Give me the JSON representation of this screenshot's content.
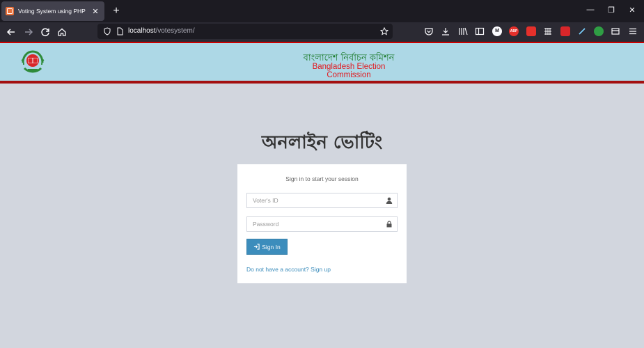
{
  "browser": {
    "tab_title": "Voting System using PHP",
    "tab_close": "✕",
    "new_tab": "+",
    "url_host": "localhost",
    "url_path": "/votesystem/",
    "window_controls": [
      "—",
      "❐",
      "✕"
    ]
  },
  "header": {
    "title_bn": "বাংলাদেশ নির্বাচন কমিশন",
    "title_en": "Bangladesh Election Commission"
  },
  "login": {
    "heading": "অনলাইন ভোটিং",
    "message": "Sign in to start your session",
    "voter_id_placeholder": "Voter's ID",
    "password_placeholder": "Password",
    "signin_label": "Sign In",
    "signup_text": "Do not have a account? Sign up"
  },
  "colors": {
    "header_bg": "#add8e6",
    "header_border": "#a30f0f",
    "page_bg": "#d2d6de",
    "button_bg": "#3c8dbc",
    "title_green": "#1a7a2a",
    "title_red": "#e2191f"
  },
  "icons": {
    "user": "user-icon",
    "lock": "lock-icon",
    "signin": "sign-in-icon"
  }
}
